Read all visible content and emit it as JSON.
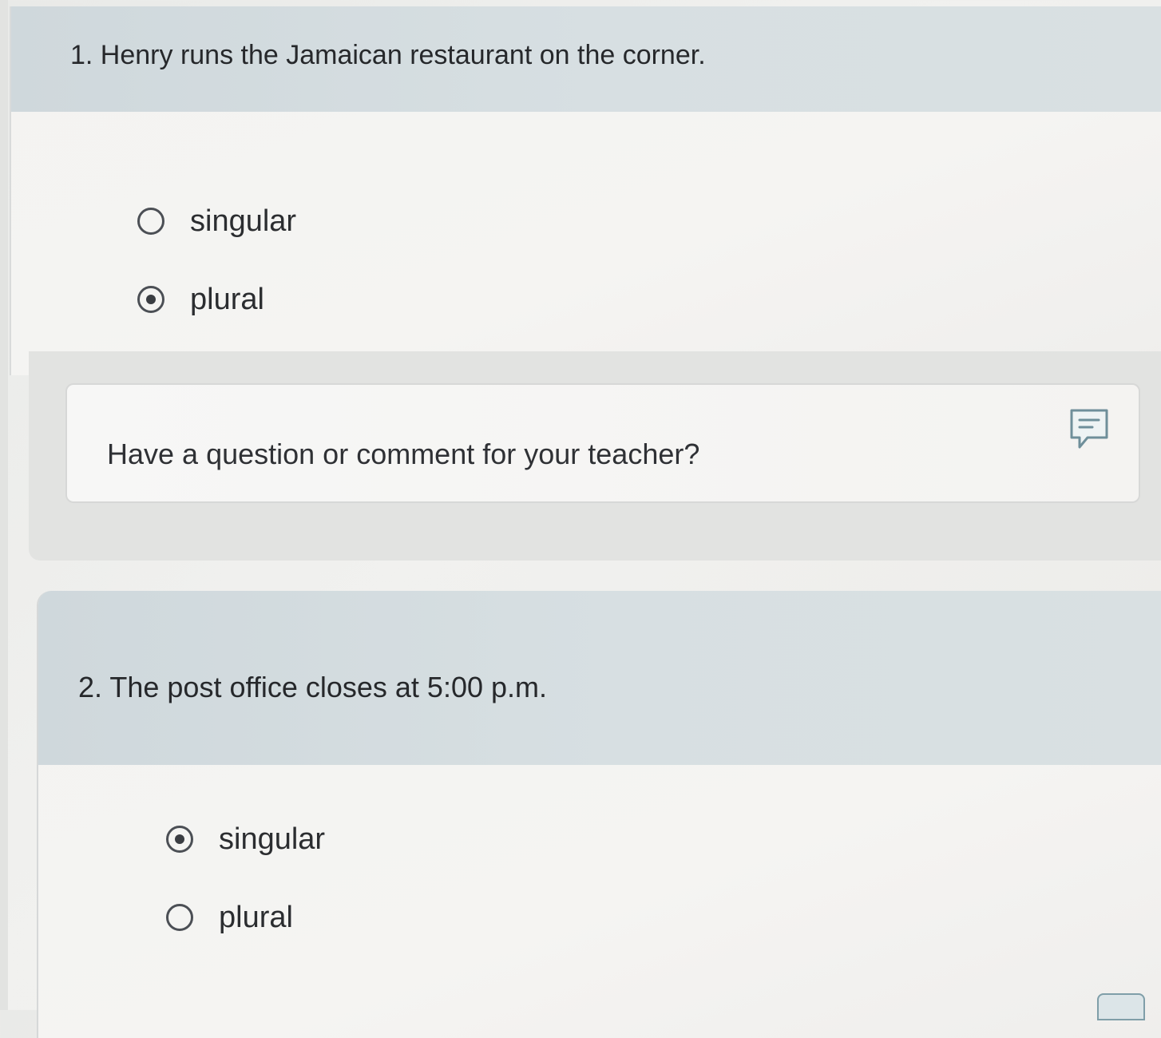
{
  "questions": [
    {
      "prompt": "1. Henry runs the Jamaican restaurant on the corner.",
      "options": [
        {
          "label": "singular",
          "selected": false
        },
        {
          "label": "plural",
          "selected": true
        }
      ]
    },
    {
      "prompt": "2. The post office closes at 5:00 p.m.",
      "options": [
        {
          "label": "singular",
          "selected": true
        },
        {
          "label": "plural",
          "selected": false
        }
      ]
    }
  ],
  "comment": {
    "prompt": "Have a question or comment for your teacher?",
    "icon": "comment-icon"
  },
  "colors": {
    "header_bg": "#d3dbdf",
    "card_bg": "#f4f4f2",
    "radio_border": "#4b4f55"
  }
}
